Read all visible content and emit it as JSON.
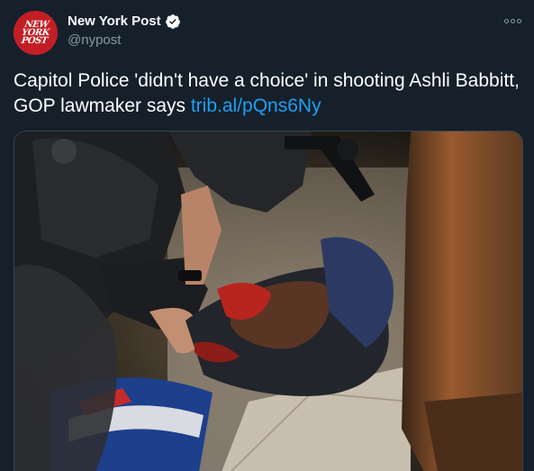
{
  "account": {
    "display_name": "New York Post",
    "handle": "@nypost",
    "logo_lines": [
      "NEW",
      "YORK",
      "POST"
    ],
    "verified": true,
    "avatar_color": "#c41e25"
  },
  "tweet": {
    "text": "Capitol Police 'didn't have a choice' in shooting Ashli Babbitt, GOP lawmaker says ",
    "link_text": "trib.al/pQns6Ny"
  },
  "icons": {
    "verified": "verified-badge-icon",
    "more": "more-options-icon"
  },
  "colors": {
    "background": "#15202b",
    "text": "#ffffff",
    "secondary_text": "#8899a6",
    "link": "#1da1f2",
    "border": "#38444d"
  }
}
